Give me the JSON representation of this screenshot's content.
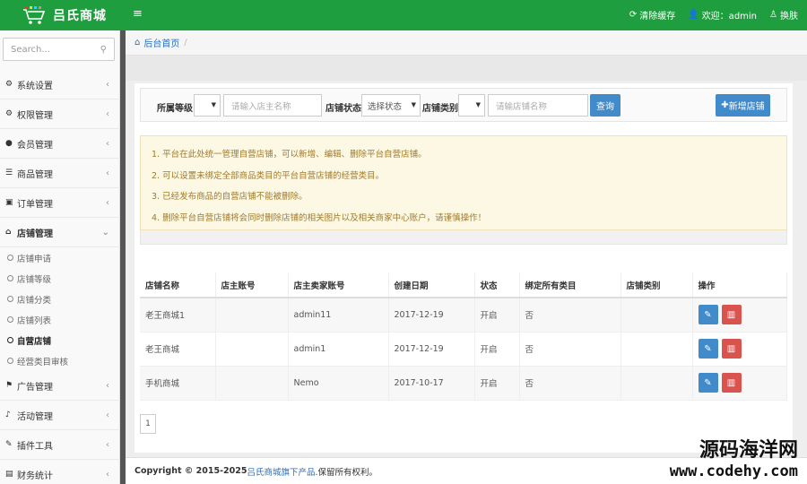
{
  "header": {
    "brand_title": "吕氏商城",
    "menu_toggle": "≡",
    "clear_cache": "清除缓存",
    "welcome": "欢迎：admin",
    "skin": "换肤",
    "color": "#1f9e3f"
  },
  "sidebar": {
    "search_placeholder": "Search...",
    "items": [
      {
        "label": "系统设置",
        "icon": "gear-icon"
      },
      {
        "label": "权限管理",
        "icon": "gears-icon"
      },
      {
        "label": "会员管理",
        "icon": "user-icon"
      },
      {
        "label": "商品管理",
        "icon": "list-icon"
      },
      {
        "label": "订单管理",
        "icon": "order-icon"
      },
      {
        "label": "店铺管理",
        "icon": "home-icon"
      }
    ],
    "sub_items": [
      "店铺申请",
      "店铺等级",
      "店铺分类",
      "店铺列表",
      "自营店铺",
      "经营类目审核"
    ],
    "items_after": [
      {
        "label": "广告管理",
        "icon": "flag-icon"
      },
      {
        "label": "活动管理",
        "icon": "bell-icon"
      },
      {
        "label": "插件工具",
        "icon": "wrench-icon"
      },
      {
        "label": "财务统计",
        "icon": "book-icon"
      }
    ]
  },
  "breadcrumb": {
    "home": "后台首页",
    "sep": "/"
  },
  "filter": {
    "level_label": "所属等级",
    "owner_placeholder": "请输入店主名称",
    "status_label": "店铺状态",
    "status_value": "选择状态",
    "category_label": "店铺类别",
    "shop_placeholder": "请输店铺名称",
    "query_btn": "查询",
    "add_btn": "新增店铺"
  },
  "notice": [
    "1. 平台在此处统一管理自营店铺，可以新增、编辑、删除平台自营店铺。",
    "2. 可以设置未绑定全部商品类目的平台自营店铺的经营类目。",
    "3. 已经发布商品的自营店铺不能被删除。",
    "4. 删除平台自营店铺将会同时删除店铺的相关图片以及相关商家中心账户，请谨慎操作！"
  ],
  "table": {
    "headers": [
      "店铺名称",
      "店主账号",
      "店主卖家账号",
      "创建日期",
      "状态",
      "绑定所有类目",
      "店铺类别",
      "操作"
    ],
    "rows": [
      {
        "name": "老王商城1",
        "owner": "",
        "seller": "admin11",
        "date": "2017-12-19",
        "status": "开启",
        "bound": "否",
        "category": ""
      },
      {
        "name": "老王商城",
        "owner": "",
        "seller": "admin1",
        "date": "2017-12-19",
        "status": "开启",
        "bound": "否",
        "category": ""
      },
      {
        "name": "手机商城",
        "owner": "",
        "seller": "Nemo",
        "date": "2017-10-17",
        "status": "开启",
        "bound": "否",
        "category": ""
      }
    ]
  },
  "pager_label": "1",
  "footer": {
    "copyright": "Copyright © 2015-2025 ",
    "brand": "吕氏商城旗下产品",
    "rights": ".保留所有权利。"
  },
  "watermark": {
    "line1": "源码海洋网",
    "line2": "www.codehy.com"
  }
}
